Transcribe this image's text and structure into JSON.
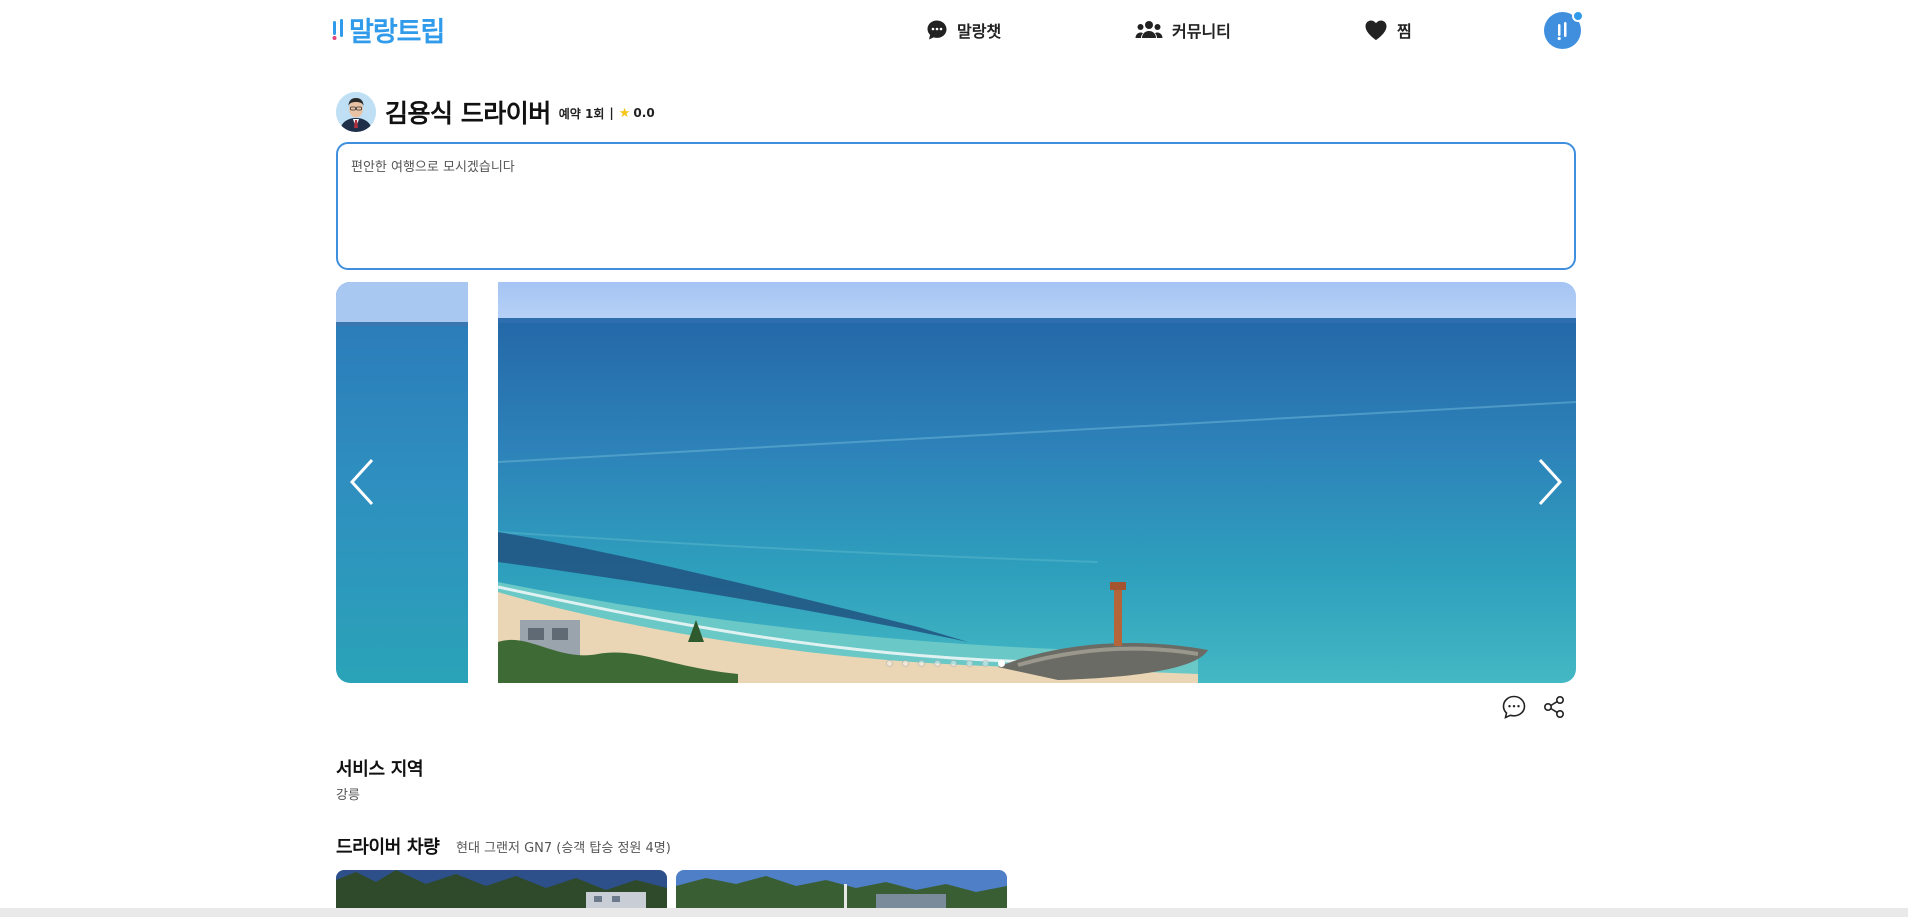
{
  "header": {
    "logo_text": "말랑트립",
    "nav": [
      {
        "label": "말랑챗",
        "icon": "chat-bubble-icon"
      },
      {
        "label": "커뮤니티",
        "icon": "users-icon"
      },
      {
        "label": "찜",
        "icon": "heart-icon"
      }
    ],
    "profile_icon": "logo-mark-icon"
  },
  "driver": {
    "name": "김용식 드라이버",
    "reservations": "예약 1회",
    "separator": "|",
    "rating": "0.0",
    "rating_icon": "star-icon"
  },
  "intro": {
    "text": "편안한 여행으로 모시겠습니다"
  },
  "carousel": {
    "slide_count": 8,
    "active_index": 7
  },
  "sections": {
    "region_title": "서비스 지역",
    "region_value": "강릉",
    "vehicle_title": "드라이버 차량",
    "vehicle_desc": "현대 그랜저 GN7 (승객 탑승 정원 4명)"
  },
  "colors": {
    "brand": "#2f9bea",
    "accent_border": "#3f8fde",
    "star": "#f5c518"
  }
}
